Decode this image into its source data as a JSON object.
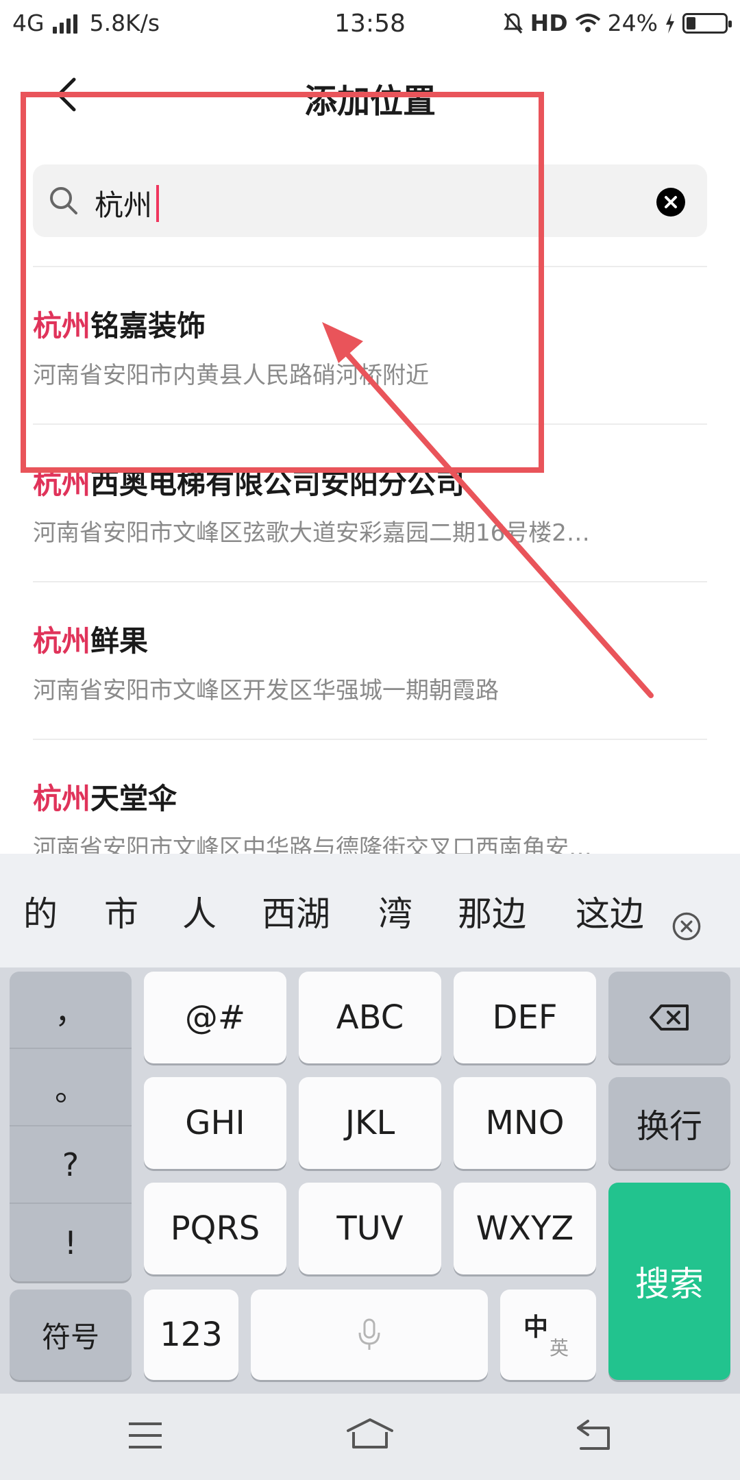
{
  "status_bar": {
    "network": "4G",
    "speed": "5.8K/s",
    "time": "13:58",
    "hd": "HD",
    "battery": "24%",
    "battery_level": 0.24
  },
  "header": {
    "title": "添加位置",
    "back_icon": "chevron-left-icon"
  },
  "search": {
    "value": "杭州",
    "search_icon": "search-icon",
    "clear_icon": "clear-icon"
  },
  "results": [
    {
      "highlight": "杭州",
      "rest": "铭嘉装饰",
      "address": "河南省安阳市内黄县人民路硝河桥附近"
    },
    {
      "highlight": "杭州",
      "rest": "西奥电梯有限公司安阳分公司",
      "address": "河南省安阳市文峰区弦歌大道安彩嘉园二期16号楼2…"
    },
    {
      "highlight": "杭州",
      "rest": "鲜果",
      "address": "河南省安阳市文峰区开发区华强城一期朝霞路"
    },
    {
      "highlight": "杭州",
      "rest": "天堂伞",
      "address": "河南省安阳市文峰区中华路与德隆街交叉口西南角安…"
    }
  ],
  "annotation_color": "#e9545a",
  "keyboard": {
    "candidates": [
      "的",
      "市",
      "人",
      "西湖",
      "湾",
      "那边",
      "这边"
    ],
    "punctuation": [
      "，",
      "。",
      "?",
      "!"
    ],
    "rows": [
      [
        "@#",
        "ABC",
        "DEF"
      ],
      [
        "GHI",
        "JKL",
        "MNO"
      ],
      [
        "PQRS",
        "TUV",
        "WXYZ"
      ]
    ],
    "newline": "换行",
    "search": "搜索",
    "symbols": "符号",
    "numbers": "123",
    "lang_main": "中",
    "lang_alt": "英",
    "accent_color": "#22c38e"
  }
}
